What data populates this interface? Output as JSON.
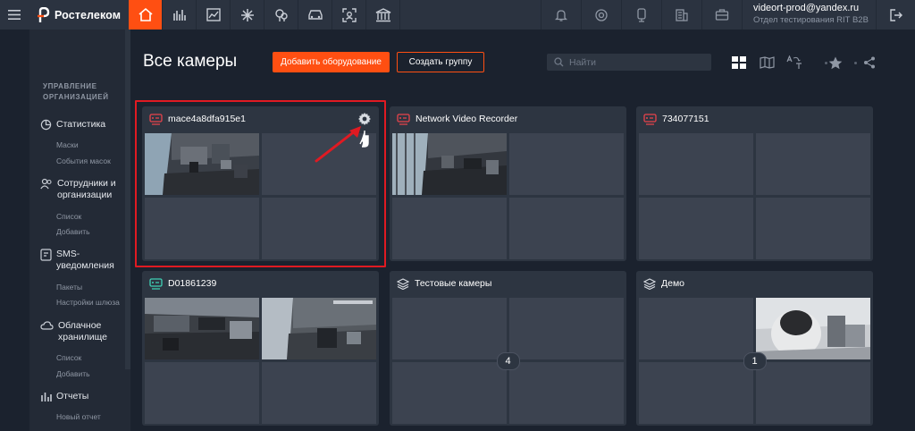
{
  "header": {
    "logo_text": "Ростелеком",
    "user_email": "videort-prod@yandex.ru",
    "user_org": "Отдел тестирования RIT B2B",
    "nav_icons": [
      "home-icon",
      "analytics-icon",
      "trend-icon",
      "snowflake-icon",
      "location-icon",
      "car-icon",
      "face-scan-icon",
      "bank-icon"
    ],
    "right_icons": [
      "bell-icon",
      "support-icon",
      "device-icon",
      "building-icon",
      "briefcase-icon"
    ],
    "accent": "#ff4f12"
  },
  "sidebar": {
    "section_title": "УПРАВЛЕНИЕ ОРГАНИЗАЦИЕЙ",
    "items": [
      {
        "label": "Статистика",
        "icon": "chart-pie-icon",
        "subs": [
          "Маски",
          "События масок"
        ]
      },
      {
        "label": "Сотрудники и организации",
        "icon": "users-icon",
        "subs": [
          "Список",
          "Добавить"
        ]
      },
      {
        "label": "SMS-уведомления",
        "icon": "sms-icon",
        "subs": [
          "Пакеты",
          "Настройки шлюза"
        ]
      },
      {
        "label": "Облачное хранилище",
        "icon": "cloud-icon",
        "subs": [
          "Список",
          "Добавить"
        ]
      },
      {
        "label": "Отчеты",
        "icon": "bar-chart-icon",
        "subs": [
          "Новый отчет"
        ]
      }
    ]
  },
  "main": {
    "title": "Все камеры",
    "add_button": "Добавить оборудование",
    "group_button": "Создать группу",
    "search_placeholder": "Найти"
  },
  "cards": [
    {
      "title": "mace4a8dfa915e1",
      "icon": "recorder-icon",
      "icon_color": "#e8434b",
      "images": [
        0
      ],
      "settings": true
    },
    {
      "title": "Network Video Recorder",
      "icon": "recorder-icon",
      "icon_color": "#e8434b",
      "images": [
        0
      ]
    },
    {
      "title": "734077151",
      "icon": "recorder-icon",
      "icon_color": "#e8434b",
      "images": []
    },
    {
      "title": "D01861239",
      "icon": "recorder-icon",
      "icon_color": "#3fd1b5",
      "images": [
        0,
        1
      ]
    },
    {
      "title": "Тестовые камеры",
      "icon": "layers-icon",
      "icon_color": "#d8dce2",
      "images": [],
      "count": "4"
    },
    {
      "title": "Демо",
      "icon": "layers-icon",
      "icon_color": "#d8dce2",
      "images": [
        3
      ],
      "count": "1"
    }
  ]
}
